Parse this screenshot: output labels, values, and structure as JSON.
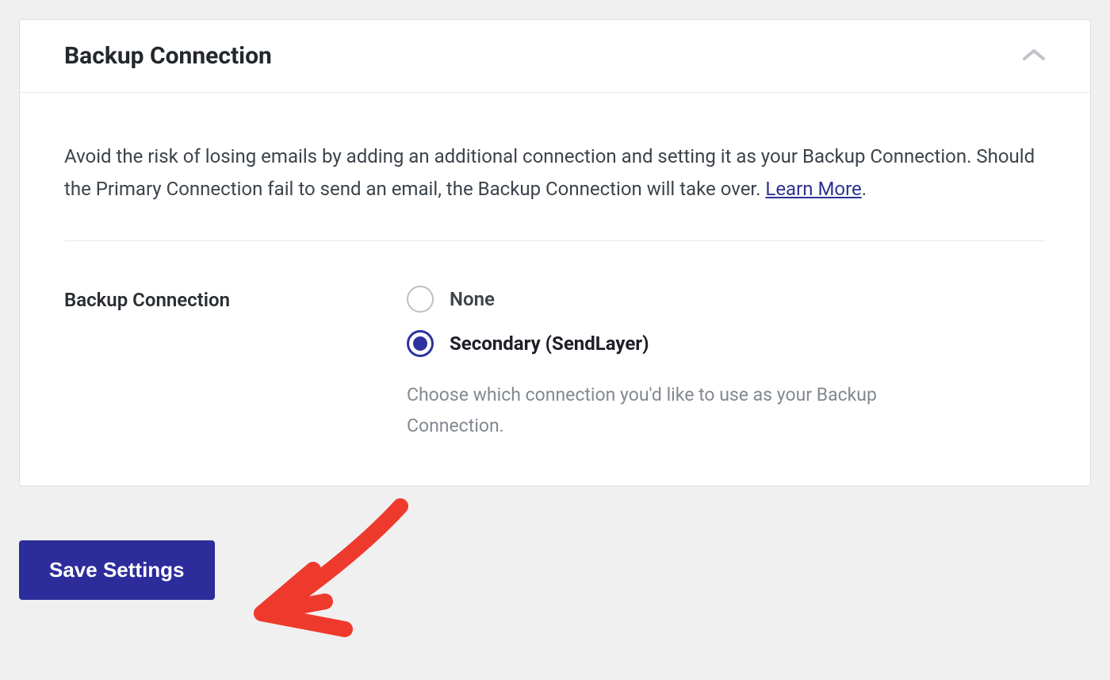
{
  "panel": {
    "title": "Backup Connection",
    "description": "Avoid the risk of losing emails by adding an additional connection and setting it as your Backup Connection. Should the Primary Connection fail to send an email, the Backup Connection will take over. ",
    "learn_more": "Learn More",
    "period": "."
  },
  "field": {
    "label": "Backup Connection",
    "options": [
      {
        "label": "None",
        "selected": false
      },
      {
        "label": "Secondary (SendLayer)",
        "selected": true
      }
    ],
    "hint": "Choose which connection you'd like to use as your Backup Connection."
  },
  "buttons": {
    "save": "Save Settings"
  }
}
